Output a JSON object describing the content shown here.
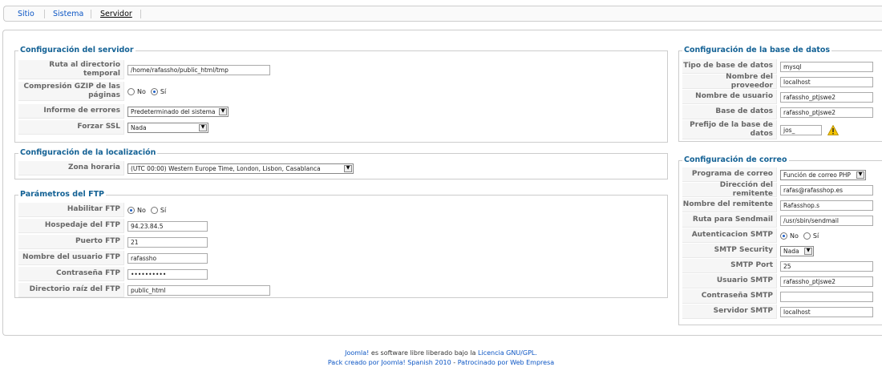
{
  "tabs": [
    "Sitio",
    "Sistema",
    "Servidor"
  ],
  "server": {
    "legend": "Configuración del servidor",
    "temp_label": "Ruta al directorio temporal",
    "temp_value": "/home/rafassho/public_html/tmp",
    "gzip_label": "Compresión GZIP de las páginas",
    "gzip_no": "No",
    "gzip_yes": "Sí",
    "gzip_selected": "Sí",
    "errors_label": "Informe de errores",
    "errors_value": "Predeterminado del sistema",
    "ssl_label": "Forzar SSL",
    "ssl_value": "Nada"
  },
  "locale": {
    "legend": "Configuración de la localización",
    "tz_label": "Zona horaria",
    "tz_value": "(UTC 00:00) Western Europe Time, London, Lisbon, Casablanca"
  },
  "ftp": {
    "legend": "Parámetros del FTP",
    "enable_label": "Habilitar FTP",
    "enable_no": "No",
    "enable_yes": "Sí",
    "enable_selected": "No",
    "host_label": "Hospedaje del FTP",
    "host_value": "94.23.84.5",
    "port_label": "Puerto FTP",
    "port_value": "21",
    "user_label": "Nombre del usuario FTP",
    "user_value": "rafassho",
    "pass_label": "Contraseña FTP",
    "pass_value": "••••••••••",
    "root_label": "Directorio raíz del FTP",
    "root_value": "public_html"
  },
  "db": {
    "legend": "Configuración de la base de datos",
    "type_label": "Tipo de base de datos",
    "type_value": "mysql",
    "host_label": "Nombre del proveedor",
    "host_value": "localhost",
    "user_label": "Nombre de usuario",
    "user_value": "rafassho_ptjswe2",
    "name_label": "Base de datos",
    "name_value": "rafassho_ptjswe2",
    "prefix_label": "Prefijo de la base de datos",
    "prefix_value": "jos_"
  },
  "mail": {
    "legend": "Configuración de correo",
    "program_label": "Programa de correo",
    "program_value": "Función de correo PHP",
    "from_label": "Dirección del remitente",
    "from_value": "rafas@rafasshop.es",
    "fromname_label": "Nombre del remitente",
    "fromname_value": "Rafasshop.s",
    "sendmail_label": "Ruta para Sendmail",
    "sendmail_value": "/usr/sbin/sendmail",
    "smtpauth_label": "Autenticacion SMTP",
    "smtpauth_no": "No",
    "smtpauth_yes": "Sí",
    "smtpauth_selected": "No",
    "security_label": "SMTP Security",
    "security_value": "Nada",
    "port_label": "SMTP Port",
    "port_value": "25",
    "user_label": "Usuario SMTP",
    "user_value": "rafassho_ptjswe2",
    "pass_label": "Contraseña SMTP",
    "pass_value": "",
    "server_label": "Servidor SMTP",
    "server_value": "localhost"
  },
  "footer": {
    "line1_link": "Joomla!",
    "line1_text": " es software libre liberado bajo la ",
    "line1_link2": "Licencia GNU/GPL.",
    "line2_link": "Pack creado por Joomla! Spanish 2010",
    "line2_sep": " - ",
    "line2_link2": "Patrocinado por Web Empresa"
  },
  "colors": {
    "legend": "#146295",
    "link": "#0b55c4",
    "label_bg": "#f6f6f6",
    "radio_on": "#1d5fc7",
    "warning": "#f4c400"
  },
  "icons": [
    "warning-icon",
    "chevron-down-icon"
  ]
}
